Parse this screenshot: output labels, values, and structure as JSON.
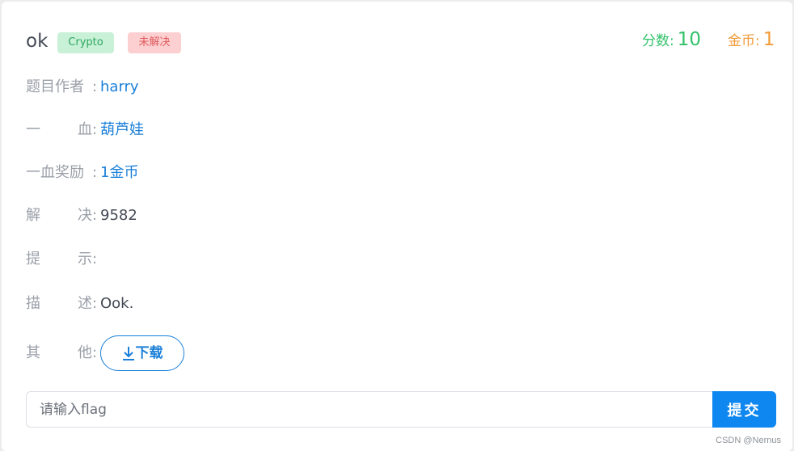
{
  "challenge": {
    "title": "ok",
    "category": "Crypto",
    "status": "未解决",
    "score_label": "分数:",
    "score_value": "10",
    "coins_label": "金币:",
    "coins_value": "1"
  },
  "details": {
    "author": {
      "label": "题目作者",
      "value": "harry"
    },
    "first_blood": {
      "label_chars": [
        "一",
        "血"
      ],
      "value": "葫芦娃"
    },
    "first_blood_reward": {
      "label": "一血奖励",
      "value": "1金币"
    },
    "solves": {
      "label_chars": [
        "解",
        "决"
      ],
      "value": "9582"
    },
    "hint": {
      "label_chars": [
        "提",
        "示"
      ],
      "value": ""
    },
    "description": {
      "label_chars": [
        "描",
        "述"
      ],
      "value": "Ook."
    },
    "other": {
      "label_chars": [
        "其",
        "他"
      ],
      "download_label": "下载"
    },
    "colon": ":"
  },
  "flag_form": {
    "placeholder": "请输入flag",
    "value": "",
    "submit_label": "提交"
  },
  "watermark": "CSDN @Nernus",
  "colors": {
    "link": "#1a7fd8",
    "primary_button": "#0f87f0",
    "score": "#33c26a",
    "coins": "#f29a37",
    "tag_category_bg": "#c8f1d8",
    "tag_status_bg": "#fccfd0"
  }
}
